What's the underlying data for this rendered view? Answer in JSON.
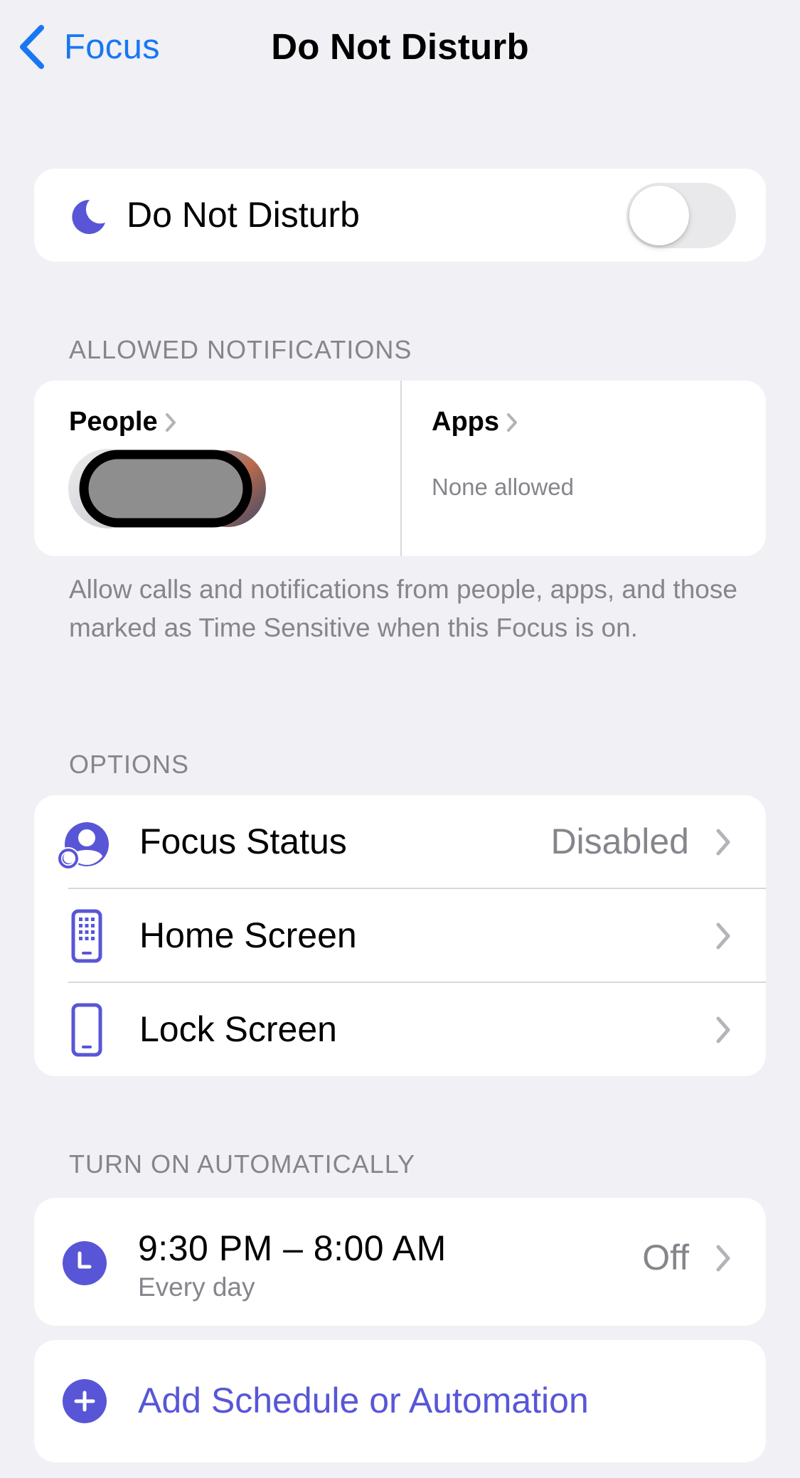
{
  "nav": {
    "back_label": "Focus",
    "title": "Do Not Disturb"
  },
  "focus_toggle": {
    "label": "Do Not Disturb",
    "icon": "moon-icon",
    "enabled": false
  },
  "allowed_notifications": {
    "header": "ALLOWED NOTIFICATIONS",
    "people": {
      "label": "People",
      "avatars": "redacted"
    },
    "apps": {
      "label": "Apps",
      "value": "None allowed"
    },
    "footnote": "Allow calls and notifications from people, apps, and those marked as Time Sensitive when this Focus is on."
  },
  "options": {
    "header": "OPTIONS",
    "items": [
      {
        "label": "Focus Status",
        "value": "Disabled",
        "icon": "focus-status-icon"
      },
      {
        "label": "Home Screen",
        "value": "",
        "icon": "home-screen-icon"
      },
      {
        "label": "Lock Screen",
        "value": "",
        "icon": "lock-screen-icon"
      }
    ]
  },
  "automation": {
    "header": "TURN ON AUTOMATICALLY",
    "schedule": {
      "time": "9:30 PM – 8:00 AM",
      "repeat": "Every day",
      "status": "Off",
      "icon": "clock-icon"
    },
    "add_label": "Add Schedule or Automation"
  },
  "colors": {
    "background": "#F0F0F5",
    "accent_purple": "#5856D6",
    "link_blue": "#1877F2",
    "secondary_text": "#85858C"
  }
}
